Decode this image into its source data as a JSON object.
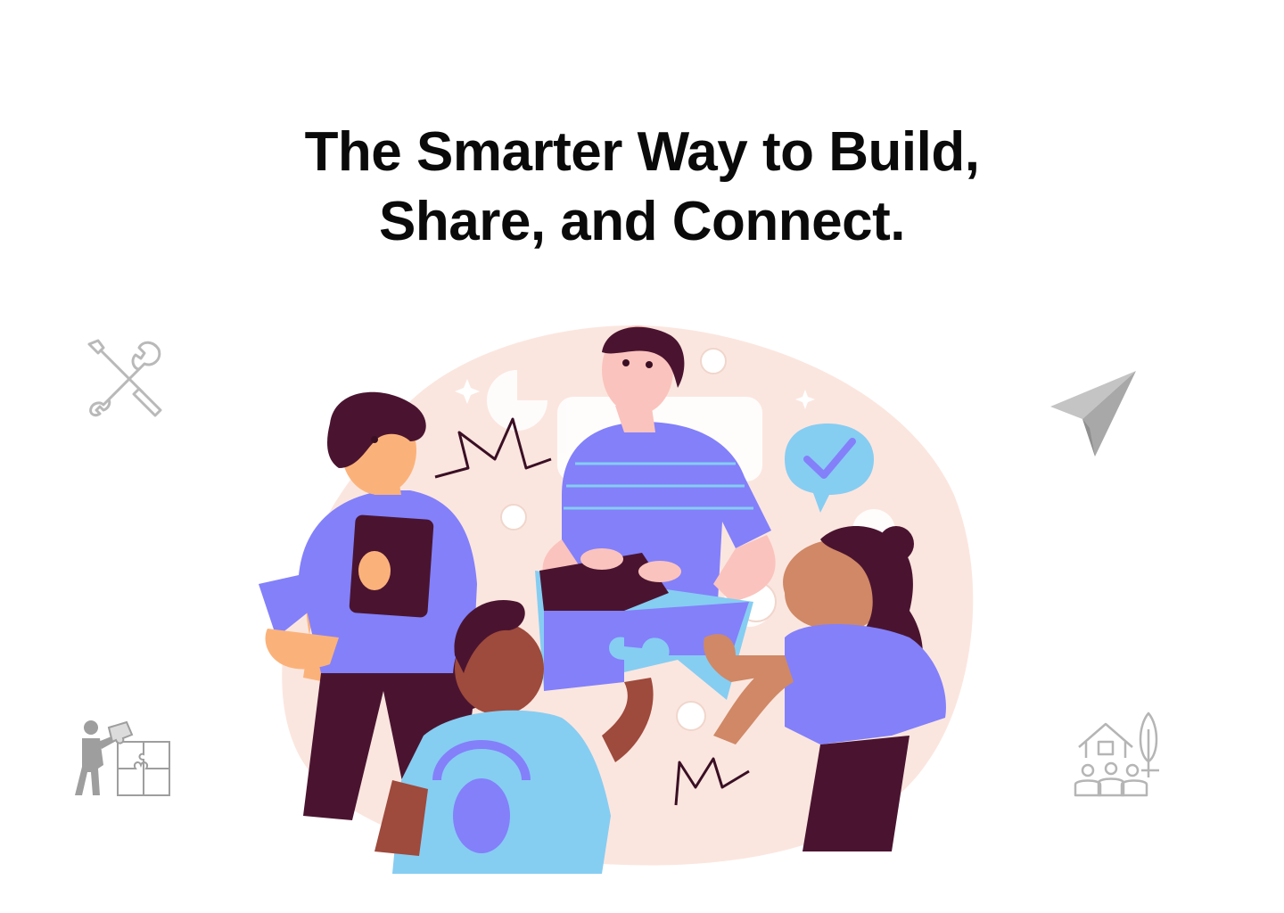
{
  "hero": {
    "headline_line1": "The Smarter Way to Build,",
    "headline_line2": "Share, and Connect."
  },
  "illustration": {
    "subject": "team-assembling-puzzle"
  },
  "decorative_icons": [
    "tools-icon",
    "paper-plane-icon",
    "puzzle-worker-icon",
    "community-house-icon"
  ],
  "colors": {
    "heading": "#0a0a0a",
    "accent_purple": "#8380fa",
    "accent_blue": "#86cdf2",
    "dark_plum": "#4a1430",
    "blush": "#fbe6df",
    "icon_gray": "#b9b9b9"
  }
}
